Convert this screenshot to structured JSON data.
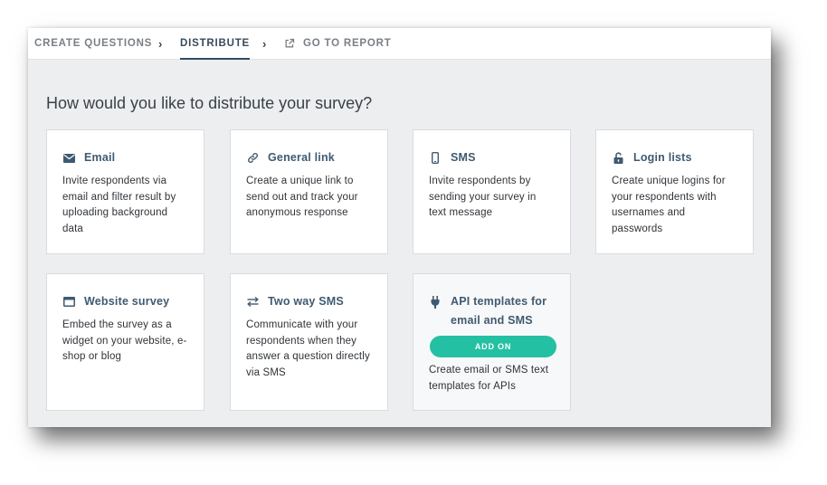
{
  "nav": {
    "steps": [
      {
        "label": "CREATE QUESTIONS"
      },
      {
        "label": "DISTRIBUTE"
      },
      {
        "label": "GO TO REPORT"
      }
    ]
  },
  "main": {
    "heading": "How would you like to distribute your survey?",
    "cards": [
      {
        "title": "Email",
        "icon": "envelope-icon",
        "description": "Invite respondents via email and filter result by uploading background data"
      },
      {
        "title": "General link",
        "icon": "link-icon",
        "description": "Create a unique link to send out and track your anonymous response"
      },
      {
        "title": "SMS",
        "icon": "phone-icon",
        "description": "Invite respondents by sending your survey in text message"
      },
      {
        "title": "Login lists",
        "icon": "unlock-icon",
        "description": "Create unique logins for your respondents with usernames and passwords"
      },
      {
        "title": "Website survey",
        "icon": "browser-window-icon",
        "description": "Embed the survey as a widget on your website, e-shop or blog"
      },
      {
        "title": "Two way SMS",
        "icon": "swap-arrows-icon",
        "description": "Communicate with your respondents when they answer a question directly via SMS"
      },
      {
        "title": "API templates for email and SMS",
        "icon": "plug-icon",
        "badge": "ADD ON",
        "description": "Create email or SMS text templates for APIs"
      }
    ]
  },
  "colors": {
    "accent": "#24c0a3",
    "title": "#3f5a70",
    "background": "#edeef0"
  }
}
